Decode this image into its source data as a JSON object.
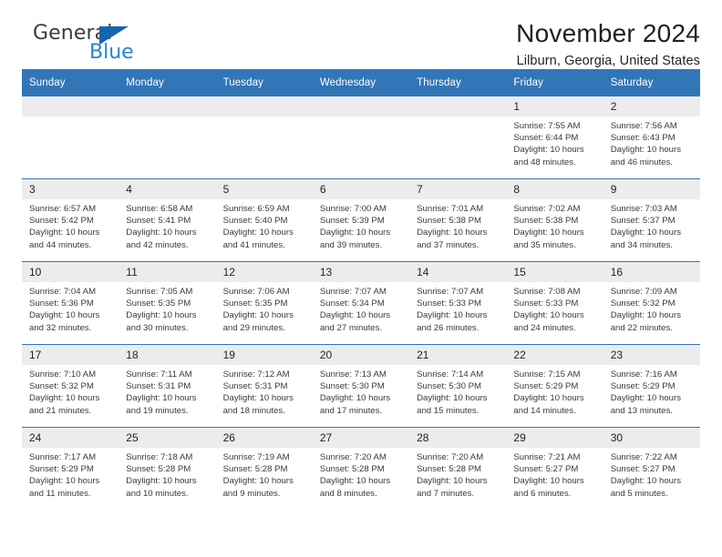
{
  "brand": {
    "name_part1": "General",
    "name_part2": "Blue",
    "accent_color": "#2585d6",
    "triangle_color": "#1565b0"
  },
  "header": {
    "title": "November 2024",
    "subtitle": "Lilburn, Georgia, United States",
    "header_bg_color": "#3276b8",
    "daynum_bg_color": "#ececec"
  },
  "weekdays": [
    "Sunday",
    "Monday",
    "Tuesday",
    "Wednesday",
    "Thursday",
    "Friday",
    "Saturday"
  ],
  "labels": {
    "sunrise": "Sunrise:",
    "sunset": "Sunset:",
    "daylight": "Daylight:"
  },
  "weeks": [
    [
      {
        "day": "",
        "blank": true
      },
      {
        "day": "",
        "blank": true
      },
      {
        "day": "",
        "blank": true
      },
      {
        "day": "",
        "blank": true
      },
      {
        "day": "",
        "blank": true
      },
      {
        "day": "1",
        "sunrise": "Sunrise: 7:55 AM",
        "sunset": "Sunset: 6:44 PM",
        "daylight1": "Daylight: 10 hours",
        "daylight2": "and 48 minutes."
      },
      {
        "day": "2",
        "sunrise": "Sunrise: 7:56 AM",
        "sunset": "Sunset: 6:43 PM",
        "daylight1": "Daylight: 10 hours",
        "daylight2": "and 46 minutes."
      }
    ],
    [
      {
        "day": "3",
        "sunrise": "Sunrise: 6:57 AM",
        "sunset": "Sunset: 5:42 PM",
        "daylight1": "Daylight: 10 hours",
        "daylight2": "and 44 minutes."
      },
      {
        "day": "4",
        "sunrise": "Sunrise: 6:58 AM",
        "sunset": "Sunset: 5:41 PM",
        "daylight1": "Daylight: 10 hours",
        "daylight2": "and 42 minutes."
      },
      {
        "day": "5",
        "sunrise": "Sunrise: 6:59 AM",
        "sunset": "Sunset: 5:40 PM",
        "daylight1": "Daylight: 10 hours",
        "daylight2": "and 41 minutes."
      },
      {
        "day": "6",
        "sunrise": "Sunrise: 7:00 AM",
        "sunset": "Sunset: 5:39 PM",
        "daylight1": "Daylight: 10 hours",
        "daylight2": "and 39 minutes."
      },
      {
        "day": "7",
        "sunrise": "Sunrise: 7:01 AM",
        "sunset": "Sunset: 5:38 PM",
        "daylight1": "Daylight: 10 hours",
        "daylight2": "and 37 minutes."
      },
      {
        "day": "8",
        "sunrise": "Sunrise: 7:02 AM",
        "sunset": "Sunset: 5:38 PM",
        "daylight1": "Daylight: 10 hours",
        "daylight2": "and 35 minutes."
      },
      {
        "day": "9",
        "sunrise": "Sunrise: 7:03 AM",
        "sunset": "Sunset: 5:37 PM",
        "daylight1": "Daylight: 10 hours",
        "daylight2": "and 34 minutes."
      }
    ],
    [
      {
        "day": "10",
        "sunrise": "Sunrise: 7:04 AM",
        "sunset": "Sunset: 5:36 PM",
        "daylight1": "Daylight: 10 hours",
        "daylight2": "and 32 minutes."
      },
      {
        "day": "11",
        "sunrise": "Sunrise: 7:05 AM",
        "sunset": "Sunset: 5:35 PM",
        "daylight1": "Daylight: 10 hours",
        "daylight2": "and 30 minutes."
      },
      {
        "day": "12",
        "sunrise": "Sunrise: 7:06 AM",
        "sunset": "Sunset: 5:35 PM",
        "daylight1": "Daylight: 10 hours",
        "daylight2": "and 29 minutes."
      },
      {
        "day": "13",
        "sunrise": "Sunrise: 7:07 AM",
        "sunset": "Sunset: 5:34 PM",
        "daylight1": "Daylight: 10 hours",
        "daylight2": "and 27 minutes."
      },
      {
        "day": "14",
        "sunrise": "Sunrise: 7:07 AM",
        "sunset": "Sunset: 5:33 PM",
        "daylight1": "Daylight: 10 hours",
        "daylight2": "and 26 minutes."
      },
      {
        "day": "15",
        "sunrise": "Sunrise: 7:08 AM",
        "sunset": "Sunset: 5:33 PM",
        "daylight1": "Daylight: 10 hours",
        "daylight2": "and 24 minutes."
      },
      {
        "day": "16",
        "sunrise": "Sunrise: 7:09 AM",
        "sunset": "Sunset: 5:32 PM",
        "daylight1": "Daylight: 10 hours",
        "daylight2": "and 22 minutes."
      }
    ],
    [
      {
        "day": "17",
        "sunrise": "Sunrise: 7:10 AM",
        "sunset": "Sunset: 5:32 PM",
        "daylight1": "Daylight: 10 hours",
        "daylight2": "and 21 minutes."
      },
      {
        "day": "18",
        "sunrise": "Sunrise: 7:11 AM",
        "sunset": "Sunset: 5:31 PM",
        "daylight1": "Daylight: 10 hours",
        "daylight2": "and 19 minutes."
      },
      {
        "day": "19",
        "sunrise": "Sunrise: 7:12 AM",
        "sunset": "Sunset: 5:31 PM",
        "daylight1": "Daylight: 10 hours",
        "daylight2": "and 18 minutes."
      },
      {
        "day": "20",
        "sunrise": "Sunrise: 7:13 AM",
        "sunset": "Sunset: 5:30 PM",
        "daylight1": "Daylight: 10 hours",
        "daylight2": "and 17 minutes."
      },
      {
        "day": "21",
        "sunrise": "Sunrise: 7:14 AM",
        "sunset": "Sunset: 5:30 PM",
        "daylight1": "Daylight: 10 hours",
        "daylight2": "and 15 minutes."
      },
      {
        "day": "22",
        "sunrise": "Sunrise: 7:15 AM",
        "sunset": "Sunset: 5:29 PM",
        "daylight1": "Daylight: 10 hours",
        "daylight2": "and 14 minutes."
      },
      {
        "day": "23",
        "sunrise": "Sunrise: 7:16 AM",
        "sunset": "Sunset: 5:29 PM",
        "daylight1": "Daylight: 10 hours",
        "daylight2": "and 13 minutes."
      }
    ],
    [
      {
        "day": "24",
        "sunrise": "Sunrise: 7:17 AM",
        "sunset": "Sunset: 5:29 PM",
        "daylight1": "Daylight: 10 hours",
        "daylight2": "and 11 minutes."
      },
      {
        "day": "25",
        "sunrise": "Sunrise: 7:18 AM",
        "sunset": "Sunset: 5:28 PM",
        "daylight1": "Daylight: 10 hours",
        "daylight2": "and 10 minutes."
      },
      {
        "day": "26",
        "sunrise": "Sunrise: 7:19 AM",
        "sunset": "Sunset: 5:28 PM",
        "daylight1": "Daylight: 10 hours",
        "daylight2": "and 9 minutes."
      },
      {
        "day": "27",
        "sunrise": "Sunrise: 7:20 AM",
        "sunset": "Sunset: 5:28 PM",
        "daylight1": "Daylight: 10 hours",
        "daylight2": "and 8 minutes."
      },
      {
        "day": "28",
        "sunrise": "Sunrise: 7:20 AM",
        "sunset": "Sunset: 5:28 PM",
        "daylight1": "Daylight: 10 hours",
        "daylight2": "and 7 minutes."
      },
      {
        "day": "29",
        "sunrise": "Sunrise: 7:21 AM",
        "sunset": "Sunset: 5:27 PM",
        "daylight1": "Daylight: 10 hours",
        "daylight2": "and 6 minutes."
      },
      {
        "day": "30",
        "sunrise": "Sunrise: 7:22 AM",
        "sunset": "Sunset: 5:27 PM",
        "daylight1": "Daylight: 10 hours",
        "daylight2": "and 5 minutes."
      }
    ]
  ]
}
